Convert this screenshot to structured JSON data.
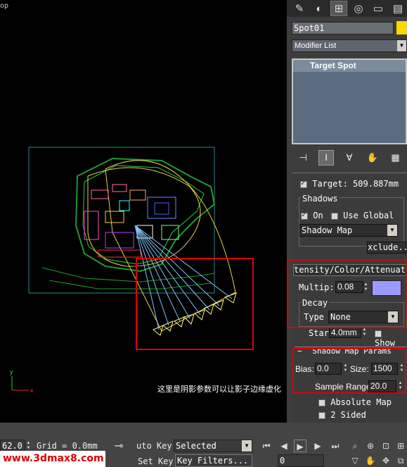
{
  "viewport": {
    "label": "op",
    "caption": "这里是阴影参数可以让影子边缘虚化",
    "axis_y": "y",
    "axis_x": "x"
  },
  "panel": {
    "tabs": [
      "create-icon",
      "modify-icon",
      "hierarchy-icon",
      "motion-icon",
      "display-icon",
      "utilities-icon"
    ],
    "object_name": "Spot01",
    "object_color": "#ffd800",
    "modifier_list": "Modifier List",
    "stack_item": "Target Spot",
    "target_label": "Target:",
    "target_value": "509.887mm",
    "shadows": {
      "group": "Shadows",
      "on_label": "On",
      "use_global_label": "Use Global",
      "type": "Shadow Map",
      "exclude": "xclude.."
    },
    "intensity": {
      "header": "tensity/Color/Attenuati",
      "multiplier_label": "Multip:",
      "multiplier_value": "0.08",
      "color": "#9b9bff",
      "decay_group": "Decay",
      "decay_type_label": "Type",
      "decay_type_value": "None",
      "start_label": "Star",
      "start_value": "4.0mm",
      "show_label": "Show"
    },
    "shadow_map": {
      "header": "Shadow Map Params",
      "bias_label": "Bias:",
      "bias_value": "0.0",
      "size_label": "Size:",
      "size_value": "1500",
      "sample_range_label": "Sample Range:",
      "sample_range_value": "20.0",
      "absolute_map_label": "Absolute Map",
      "two_sided_label": "2 Sided"
    }
  },
  "bottom": {
    "coord_value": "62.0",
    "grid": "Grid = 0.0mm",
    "auto_key": "uto Key",
    "selected": "Selected",
    "set_key": "Set Key",
    "key_filters": "Key Filters...",
    "frame": "0",
    "watermark": "www.3dmax8.com"
  }
}
